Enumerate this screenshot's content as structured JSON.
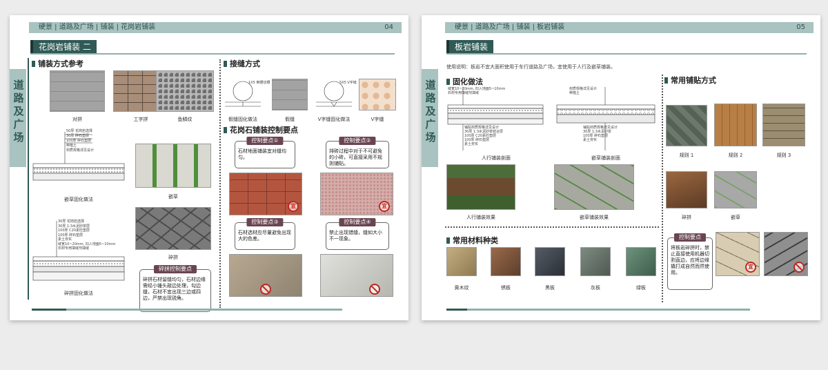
{
  "left": {
    "header": "硬景 | 道路及广场 | 铺装 | 花岗岩铺装",
    "page_number": "04",
    "title": "花岗岩铺装 二",
    "side_title": "道路及广场",
    "sections": {
      "patterns": "铺装方式参考",
      "joints": "接缝方式",
      "control": "花岗石铺装控制要点"
    },
    "pattern_captions": [
      "对拼",
      "工字拼",
      "鱼鳞纹"
    ],
    "grass": {
      "diagram_caption": "嵌草固化做法",
      "photo_caption": "嵌草",
      "notes": [
        "50厚 花岗岩选择",
        "30厚 碎石垫层",
        "100厚 碎石垫层",
        "种植土",
        "材质规格详见设计"
      ]
    },
    "crazy": {
      "diagram_caption": "碎拼固化做法",
      "photo_caption": "碎拼",
      "notes": [
        "30厚 花岗岩选择",
        "30厚 1:3水泥砂浆层",
        "100厚 C20素砼垫层",
        "100厚 碎石垫层",
        "素土夯实",
        "缝宽10~20mm, 凹入地面5~10mm",
        "石材专用填缝剂填缝"
      ]
    },
    "joint_captions": [
      "假缝固化做法",
      "假缝",
      "V字缝固化做法",
      "V字缝"
    ],
    "joint_notes": [
      "1X5 倒槽切槽",
      "5X5 V字缝"
    ],
    "crazy_tip": {
      "tag": "碎拼控制要点",
      "text": "碎拼石材留缝均匀，石材边缘需经小锤头敲边处理，勾边缝，石材不宜出现三边或四边，严禁出现锐角。"
    },
    "control_points": [
      {
        "tag": "控制要点①",
        "text": "石材地面铺装宜对缝均匀。",
        "mark": "宜"
      },
      {
        "tag": "控制要点②",
        "text": "排砖过程中对于不可避免的小砖，可直接采用不规则铺贴。",
        "mark": "宜"
      },
      {
        "tag": "控制要点③",
        "text": "石材选材应尽量避免出现大的色差。",
        "mark": "no"
      },
      {
        "tag": "控制要点④",
        "text": "禁止出现错缝，缝如大小不一现象。",
        "mark": "no"
      }
    ]
  },
  "right": {
    "header": "硬景 | 道路及广场 | 铺装 | 板岩铺装",
    "page_number": "05",
    "title": "板岩铺装",
    "side_title": "道路及广场",
    "usage": "使用说明：板岩不宜大面积使用于车行道路及广场，宜使用于人行及嵌草铺装。",
    "sections": {
      "fix": "固化做法",
      "paving": "常用铺贴方式",
      "materials": "常用材料种类"
    },
    "fix_diagram_notes_a": [
      "缝宽10~20mm, 凹入地面5~10mm",
      "石材专用填缝剂填缝",
      "铺贴材质规格详见设计",
      "30厚 1:3水泥砂浆结合层",
      "100厚 C20素砼垫层",
      "100厚 碎石垫层",
      "素土夯实"
    ],
    "fix_diagram_notes_b": [
      "材质规格详见设计",
      "种植土",
      "铺贴材质规格详见设计",
      "30厚 1:3水泥砂浆",
      "100厚 碎石垫层",
      "素土夯实"
    ],
    "fix_captions": [
      "人行铺装剖面",
      "嵌草铺装剖面",
      "人行铺装效果",
      "嵌草铺装效果"
    ],
    "paving_captions": [
      "规则 1",
      "规则 2",
      "规则 3",
      "碎拼",
      "嵌草"
    ],
    "material_captions": [
      "黄木纹",
      "锈板",
      "黑板",
      "灰板",
      "绿板"
    ],
    "tip": {
      "tag": "控制要点",
      "text": "将板岩碎拼时，禁止直接使用机器切割直边，应将边缘撬打成自然而然使用。",
      "mark": "宜"
    }
  },
  "colors": {
    "accent_dark": "#2f5a55",
    "accent_light": "#a9c3c0",
    "tag": "#6a4550",
    "warning": "#c0261f"
  }
}
